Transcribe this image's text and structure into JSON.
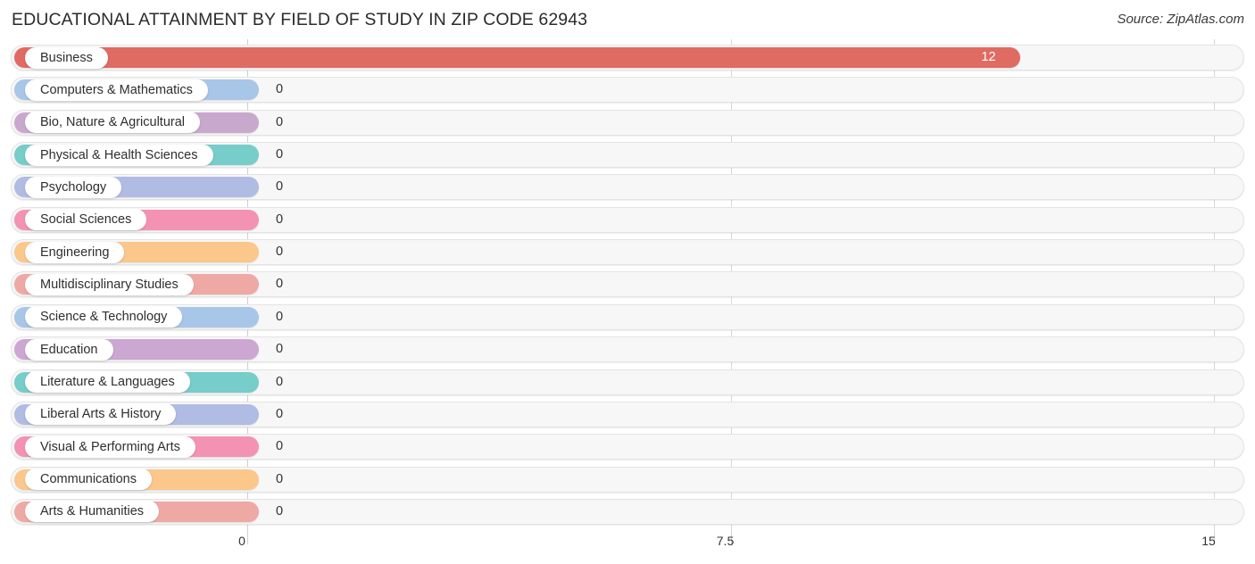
{
  "header": {
    "title": "EDUCATIONAL ATTAINMENT BY FIELD OF STUDY IN ZIP CODE 62943",
    "source": "Source: ZipAtlas.com"
  },
  "chart_data": {
    "type": "bar",
    "orientation": "horizontal",
    "title": "EDUCATIONAL ATTAINMENT BY FIELD OF STUDY IN ZIP CODE 62943",
    "subtitle": "Source: ZipAtlas.com",
    "xlabel": "",
    "ylabel": "",
    "xlim": [
      0,
      15
    ],
    "xticks": [
      0,
      7.5,
      15
    ],
    "xtick_labels": [
      "0",
      "7.5",
      "15"
    ],
    "grid": true,
    "legend": false,
    "categories": [
      "Business",
      "Computers & Mathematics",
      "Bio, Nature & Agricultural",
      "Physical & Health Sciences",
      "Psychology",
      "Social Sciences",
      "Engineering",
      "Multidisciplinary Studies",
      "Science & Technology",
      "Education",
      "Literature & Languages",
      "Liberal Arts & History",
      "Visual & Performing Arts",
      "Communications",
      "Arts & Humanities"
    ],
    "values": [
      12,
      0,
      0,
      0,
      0,
      0,
      0,
      0,
      0,
      0,
      0,
      0,
      0,
      0,
      0
    ],
    "value_labels": [
      "12",
      "0",
      "0",
      "0",
      "0",
      "0",
      "0",
      "0",
      "0",
      "0",
      "0",
      "0",
      "0",
      "0",
      "0"
    ],
    "bar_colors": [
      "#e06b63",
      "#a8c6e8",
      "#c9a8ce",
      "#76cdca",
      "#b0bce4",
      "#f492b4",
      "#fbc78b",
      "#efa9a4",
      "#a8c6e8",
      "#cba7d2",
      "#76cdca",
      "#b0bce4",
      "#f492b4",
      "#fbc78b",
      "#efa9a4"
    ]
  },
  "colors": {
    "track_fill": "#f7f7f7",
    "track_border": "#e3e3e3",
    "gridline": "#d8d8d8",
    "title_text": "#2b2b2b",
    "value_text": "#303030",
    "inbar_value_text": "#ffffff"
  }
}
